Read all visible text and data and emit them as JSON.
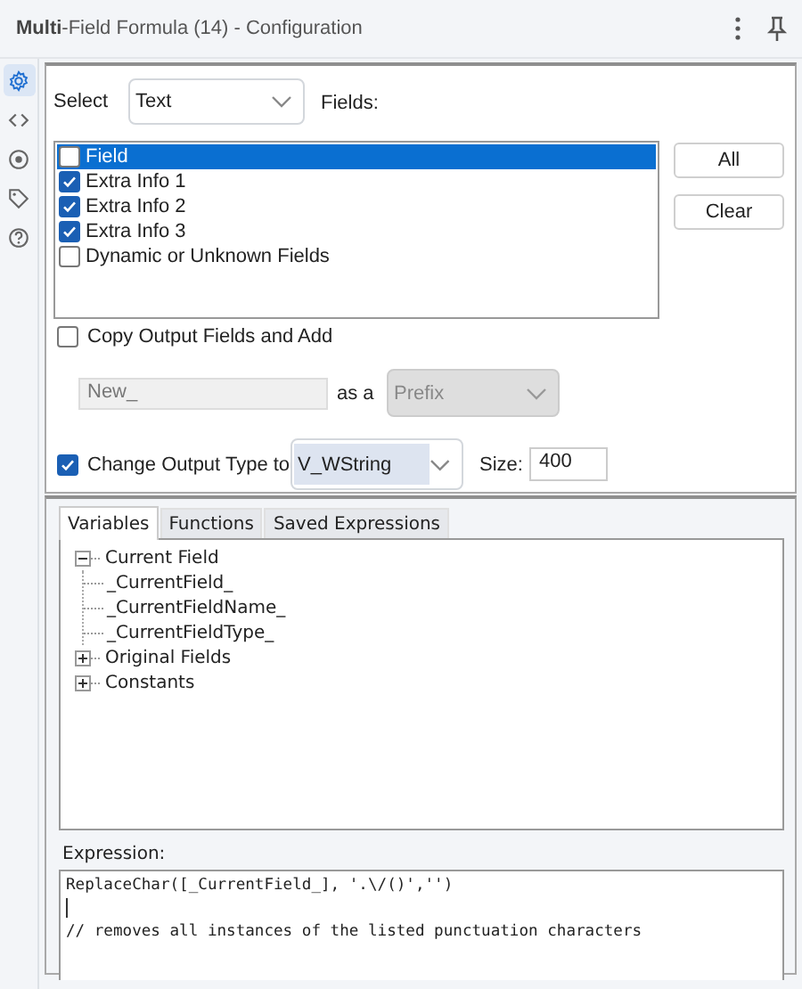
{
  "window": {
    "title": "**Multi**-Field Formula (14) - Configuration"
  },
  "rail": [
    {
      "kind": "gear",
      "selected": true
    },
    {
      "kind": "code",
      "selected": false
    },
    {
      "kind": "target",
      "selected": false
    },
    {
      "kind": "tag",
      "selected": false
    },
    {
      "kind": "help",
      "selected": false
    }
  ],
  "select": {
    "label": "Select",
    "value": "Text",
    "fields_label": "Fields:"
  },
  "fields": [
    {
      "label": "Field",
      "checked": false,
      "selected": true
    },
    {
      "label": "Extra Info 1",
      "checked": true,
      "selected": false
    },
    {
      "label": "Extra Info 2",
      "checked": true,
      "selected": false
    },
    {
      "label": "Extra Info 3",
      "checked": true,
      "selected": false
    },
    {
      "label": "Dynamic or Unknown Fields",
      "checked": false,
      "selected": false
    }
  ],
  "buttons": [
    "All",
    "Clear"
  ],
  "copy_output": {
    "label": "Copy Output Fields and Add",
    "checked": false,
    "prefix_value": "New_",
    "as_label": "as a",
    "mode": "Prefix",
    "disabled": true
  },
  "change_type": {
    "label": "Change Output Type to",
    "checked": true,
    "type": "V_WString",
    "size_label": "Size:",
    "size": "400"
  },
  "tabs": [
    {
      "label": "Variables",
      "selected": true
    },
    {
      "label": "Functions",
      "selected": false
    },
    {
      "label": "Saved Expressions",
      "selected": false
    }
  ],
  "tree": [
    {
      "label": "Current Field",
      "expanded": true,
      "children": [
        {
          "label": "_CurrentField_"
        },
        {
          "label": "_CurrentFieldName_"
        },
        {
          "label": "_CurrentFieldType_"
        }
      ]
    },
    {
      "label": "Original Fields",
      "expanded": false
    },
    {
      "label": "Constants",
      "expanded": false
    }
  ],
  "expression": {
    "label": "Expression:",
    "lines": [
      {
        "kind": "code",
        "text": "ReplaceChar([_CurrentField_], '.\\/()','')"
      },
      {
        "kind": "cursor"
      },
      {
        "kind": "comment",
        "text": "// removes all instances of the listed punctuation characters"
      }
    ]
  }
}
